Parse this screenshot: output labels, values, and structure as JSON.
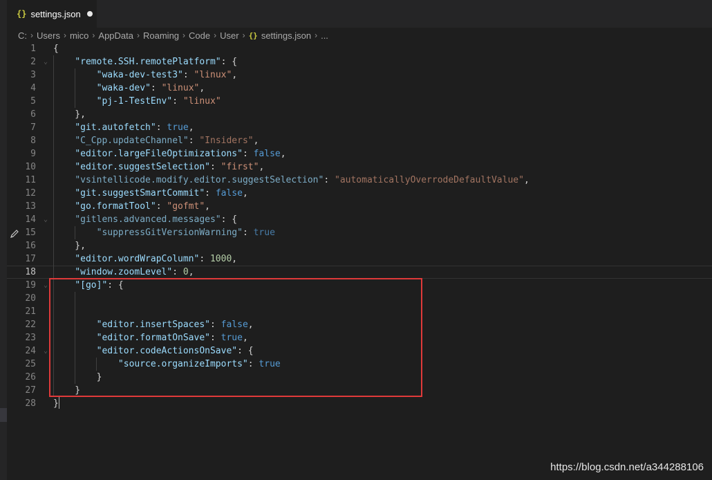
{
  "tab": {
    "icon": "json-braces-icon",
    "braces": "{}",
    "filename": "settings.json",
    "dirty_indicator": "unsaved-dot"
  },
  "breadcrumb": [
    "C:",
    "Users",
    "mico",
    "AppData",
    "Roaming",
    "Code",
    "User"
  ],
  "breadcrumb_file": {
    "braces": "{}",
    "name": "settings.json",
    "trail": "..."
  },
  "editor": {
    "active_line": 18,
    "edited_line": 12,
    "highlight_lines": [
      19,
      27
    ],
    "lines": [
      {
        "n": "1",
        "tokens": [
          [
            "p",
            "{"
          ]
        ]
      },
      {
        "n": "2",
        "tokens": [
          [
            "p",
            "    "
          ],
          [
            "k",
            "\"remote.SSH.remotePlatform\""
          ],
          [
            "p",
            ": {"
          ]
        ]
      },
      {
        "n": "3",
        "tokens": [
          [
            "p",
            "        "
          ],
          [
            "k",
            "\"waka-dev-test3\""
          ],
          [
            "p",
            ": "
          ],
          [
            "s",
            "\"linux\""
          ],
          [
            "p",
            ","
          ]
        ]
      },
      {
        "n": "4",
        "tokens": [
          [
            "p",
            "        "
          ],
          [
            "k",
            "\"waka-dev\""
          ],
          [
            "p",
            ": "
          ],
          [
            "s",
            "\"linux\""
          ],
          [
            "p",
            ","
          ]
        ]
      },
      {
        "n": "5",
        "tokens": [
          [
            "p",
            "        "
          ],
          [
            "k",
            "\"pj-1-TestEnv\""
          ],
          [
            "p",
            ": "
          ],
          [
            "s",
            "\"linux\""
          ]
        ]
      },
      {
        "n": "6",
        "tokens": [
          [
            "p",
            "    },"
          ]
        ]
      },
      {
        "n": "7",
        "tokens": [
          [
            "p",
            "    "
          ],
          [
            "k",
            "\"git.autofetch\""
          ],
          [
            "p",
            ": "
          ],
          [
            "b",
            "true"
          ],
          [
            "p",
            ","
          ]
        ]
      },
      {
        "n": "8",
        "tokens": [
          [
            "p",
            "    "
          ],
          [
            "kd",
            "\"C_Cpp.updateChannel\""
          ],
          [
            "p",
            ": "
          ],
          [
            "sd",
            "\"Insiders\""
          ],
          [
            "p",
            ","
          ]
        ]
      },
      {
        "n": "9",
        "tokens": [
          [
            "p",
            "    "
          ],
          [
            "k",
            "\"editor.largeFileOptimizations\""
          ],
          [
            "p",
            ": "
          ],
          [
            "b",
            "false"
          ],
          [
            "p",
            ","
          ]
        ]
      },
      {
        "n": "10",
        "tokens": [
          [
            "p",
            "    "
          ],
          [
            "k",
            "\"editor.suggestSelection\""
          ],
          [
            "p",
            ": "
          ],
          [
            "s",
            "\"first\""
          ],
          [
            "p",
            ","
          ]
        ]
      },
      {
        "n": "11",
        "tokens": [
          [
            "p",
            "    "
          ],
          [
            "kd",
            "\"vsintellicode.modify.editor.suggestSelection\""
          ],
          [
            "p",
            ": "
          ],
          [
            "sd",
            "\"automaticallyOverrodeDefaultValue\""
          ],
          [
            "p",
            ","
          ]
        ]
      },
      {
        "n": "12",
        "tokens": [
          [
            "p",
            "    "
          ],
          [
            "k",
            "\"git.suggestSmartCommit\""
          ],
          [
            "p",
            ": "
          ],
          [
            "b",
            "false"
          ],
          [
            "p",
            ","
          ]
        ]
      },
      {
        "n": "13",
        "tokens": [
          [
            "p",
            "    "
          ],
          [
            "k",
            "\"go.formatTool\""
          ],
          [
            "p",
            ": "
          ],
          [
            "s",
            "\"gofmt\""
          ],
          [
            "p",
            ","
          ]
        ]
      },
      {
        "n": "14",
        "tokens": [
          [
            "p",
            "    "
          ],
          [
            "kd",
            "\"gitlens.advanced.messages\""
          ],
          [
            "p",
            ": {"
          ]
        ]
      },
      {
        "n": "15",
        "tokens": [
          [
            "p",
            "        "
          ],
          [
            "kd",
            "\"suppressGitVersionWarning\""
          ],
          [
            "p",
            ": "
          ],
          [
            "bd",
            "true"
          ]
        ]
      },
      {
        "n": "16",
        "tokens": [
          [
            "p",
            "    },"
          ]
        ]
      },
      {
        "n": "17",
        "tokens": [
          [
            "p",
            "    "
          ],
          [
            "k",
            "\"editor.wordWrapColumn\""
          ],
          [
            "p",
            ": "
          ],
          [
            "n",
            "1000"
          ],
          [
            "p",
            ","
          ]
        ]
      },
      {
        "n": "18",
        "tokens": [
          [
            "p",
            "    "
          ],
          [
            "k",
            "\"window.zoomLevel\""
          ],
          [
            "p",
            ": "
          ],
          [
            "n",
            "0"
          ],
          [
            "p",
            ","
          ]
        ]
      },
      {
        "n": "19",
        "tokens": [
          [
            "p",
            "    "
          ],
          [
            "k",
            "\"[go]\""
          ],
          [
            "p",
            ": {"
          ]
        ]
      },
      {
        "n": "20",
        "tokens": []
      },
      {
        "n": "21",
        "tokens": []
      },
      {
        "n": "22",
        "tokens": [
          [
            "p",
            "        "
          ],
          [
            "k",
            "\"editor.insertSpaces\""
          ],
          [
            "p",
            ": "
          ],
          [
            "b",
            "false"
          ],
          [
            "p",
            ","
          ]
        ]
      },
      {
        "n": "23",
        "tokens": [
          [
            "p",
            "        "
          ],
          [
            "k",
            "\"editor.formatOnSave\""
          ],
          [
            "p",
            ": "
          ],
          [
            "b",
            "true"
          ],
          [
            "p",
            ","
          ]
        ]
      },
      {
        "n": "24",
        "tokens": [
          [
            "p",
            "        "
          ],
          [
            "k",
            "\"editor.codeActionsOnSave\""
          ],
          [
            "p",
            ": {"
          ]
        ]
      },
      {
        "n": "25",
        "tokens": [
          [
            "p",
            "            "
          ],
          [
            "k",
            "\"source.organizeImports\""
          ],
          [
            "p",
            ": "
          ],
          [
            "b",
            "true"
          ]
        ]
      },
      {
        "n": "26",
        "tokens": [
          [
            "p",
            "        }"
          ]
        ]
      },
      {
        "n": "27",
        "tokens": [
          [
            "p",
            "    }"
          ]
        ]
      },
      {
        "n": "28",
        "tokens": [
          [
            "p",
            "}"
          ]
        ]
      }
    ]
  },
  "watermark": "https://blog.csdn.net/a344288106",
  "colors": {
    "key": "#9cdcfe",
    "string": "#ce9178",
    "boolean": "#569cd6",
    "number": "#b5cea8",
    "highlight_box": "#e03a3a"
  }
}
